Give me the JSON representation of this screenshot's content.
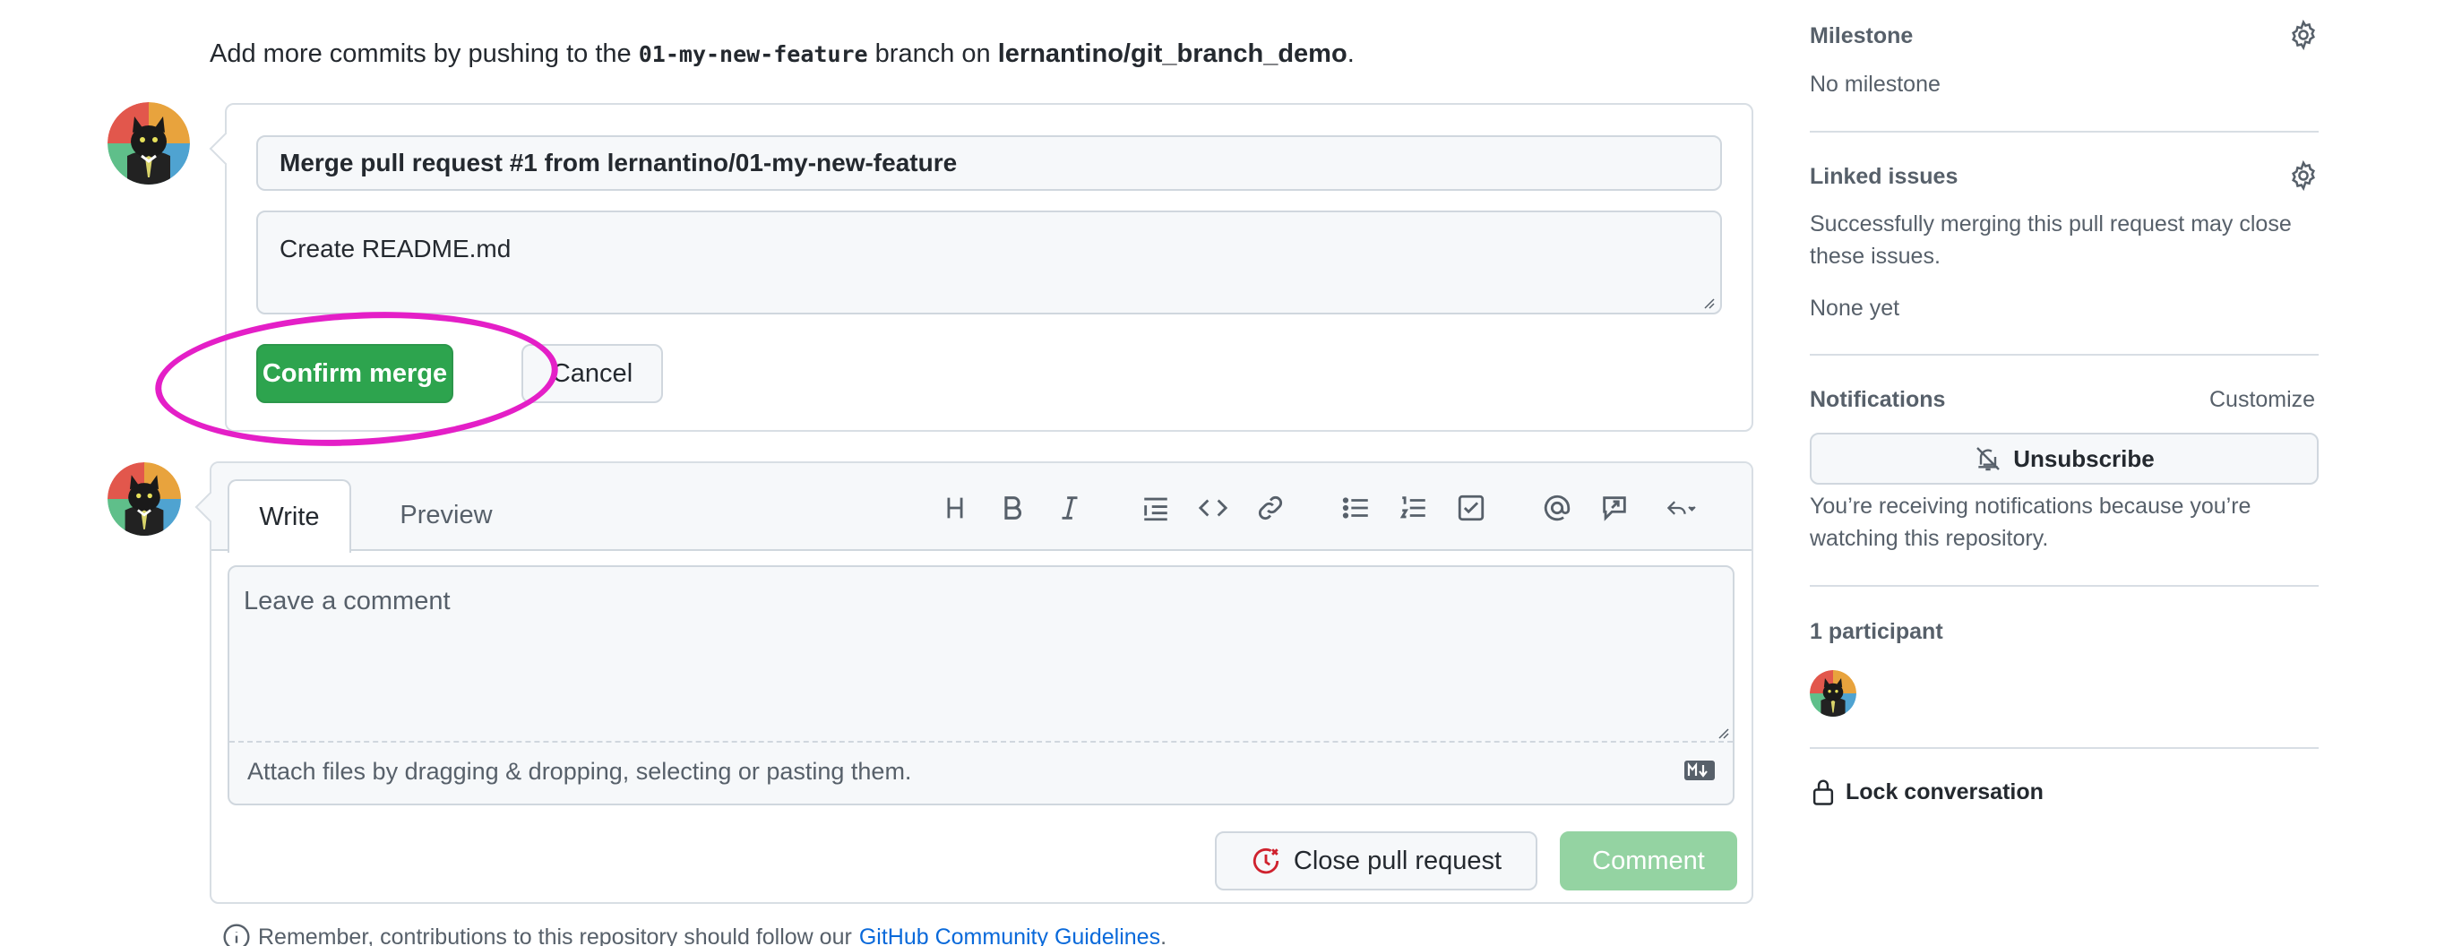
{
  "hint": {
    "prefix": "Add more commits by pushing to the",
    "branch": "01-my-new-feature",
    "middle": "branch on",
    "repo": "lernantino/git_branch_demo",
    "suffix": "."
  },
  "merge": {
    "commit_title": "Merge pull request #1 from lernantino/01-my-new-feature",
    "commit_body": "Create README.md",
    "confirm_label": "Confirm merge",
    "cancel_label": "Cancel"
  },
  "comment": {
    "tabs": [
      "Write",
      "Preview"
    ],
    "placeholder": "Leave a comment",
    "attach_hint": "Attach files by dragging & dropping, selecting or pasting them.",
    "close_label": "Close pull request",
    "comment_label": "Comment",
    "toolbar_icons": [
      "heading-icon",
      "bold-icon",
      "italic-icon",
      "quote-icon",
      "code-icon",
      "link-icon",
      "bullet-list-icon",
      "numbered-list-icon",
      "task-list-icon",
      "mention-icon",
      "reference-icon",
      "reply-icon"
    ]
  },
  "guidelines": {
    "prefix": "Remember, contributions to this repository should follow our",
    "link": "GitHub Community Guidelines",
    "suffix": "."
  },
  "sidebar": {
    "milestone": {
      "heading": "Milestone",
      "value": "No milestone"
    },
    "linked_issues": {
      "heading": "Linked issues",
      "description": "Successfully merging this pull request may close these issues.",
      "value": "None yet"
    },
    "notifications": {
      "heading": "Notifications",
      "customize": "Customize",
      "unsubscribe_label": "Unsubscribe",
      "reason": "You’re receiving notifications because you’re watching this repository."
    },
    "participants": {
      "heading": "1 participant"
    },
    "lock_label": "Lock conversation"
  },
  "colors": {
    "primary_green": "#2da44e",
    "disabled_green": "#94d3a2",
    "highlight": "#e41fc7",
    "link": "#0969da",
    "close_icon_red": "#cf222e"
  }
}
